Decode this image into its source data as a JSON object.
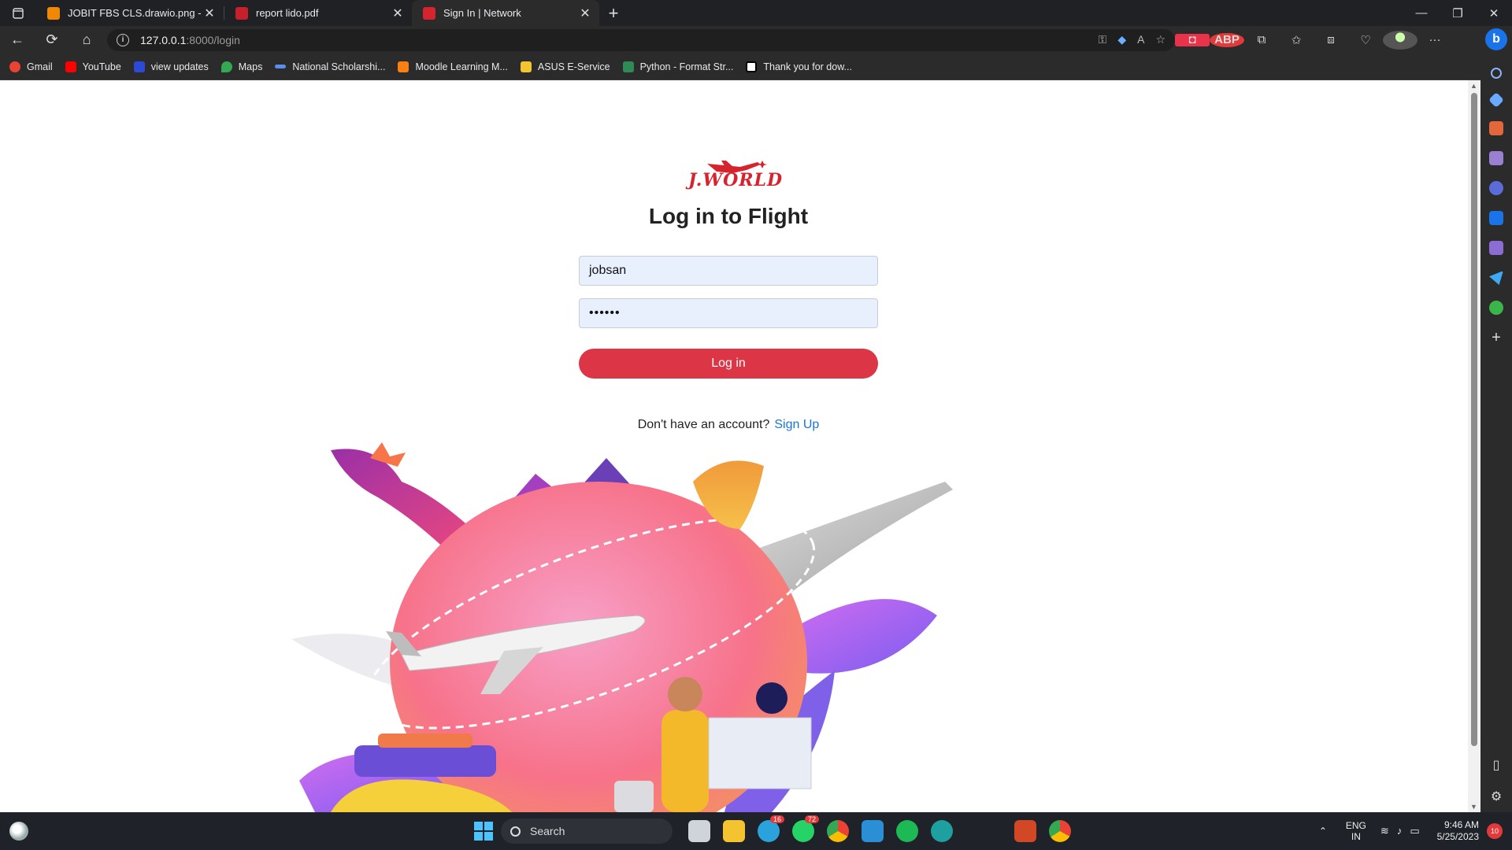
{
  "browser": {
    "tabs": [
      {
        "title": "JOBIT FBS CLS.drawio.png - draw",
        "favicon_color": "#f08705",
        "active": false
      },
      {
        "title": "report lido.pdf",
        "favicon_color": "#c8202b",
        "active": false
      },
      {
        "title": "Sign In | Network",
        "favicon_color": "#d6232e",
        "active": true
      }
    ],
    "address": {
      "host": "127.0.0.1",
      "path": ":8000/login"
    },
    "bookmarks": [
      {
        "label": "Gmail",
        "color": "#ea4335"
      },
      {
        "label": "YouTube",
        "color": "#ff0000"
      },
      {
        "label": "view updates",
        "color": "#2d4ad6"
      },
      {
        "label": "Maps",
        "color": "#34a853"
      },
      {
        "label": "National Scholarshi...",
        "color": "#5a8dee"
      },
      {
        "label": "Moodle Learning M...",
        "color": "#f98012"
      },
      {
        "label": "ASUS E-Service",
        "color": "#f4c430"
      },
      {
        "label": "Python - Format Str...",
        "color": "#2e8b57"
      },
      {
        "label": "Thank you for dow...",
        "color": "#ffffff"
      }
    ],
    "extensions": {
      "abp": "ABP"
    }
  },
  "page": {
    "logo_text": "J.WORLD",
    "title": "Log in to Flight",
    "username_value": "jobsan",
    "password_value": "••••••",
    "login_button": "Log in",
    "signup_prompt": "Don't have an account?",
    "signup_link": "Sign Up"
  },
  "taskbar": {
    "search_label": "Search",
    "apps": [
      {
        "name": "task-view",
        "color": "#cfd3da",
        "badge": null
      },
      {
        "name": "file-explorer",
        "color": "#f4c430",
        "badge": null
      },
      {
        "name": "telegram",
        "color": "#2aa3dd",
        "badge": "16"
      },
      {
        "name": "whatsapp",
        "color": "#25d366",
        "badge": "72"
      },
      {
        "name": "chrome",
        "color": "#f0b400",
        "badge": null
      },
      {
        "name": "vscode",
        "color": "#2b8fd6",
        "badge": null
      },
      {
        "name": "spotify",
        "color": "#1db954",
        "badge": null
      },
      {
        "name": "edge",
        "color": "#1ea0a0",
        "badge": null
      },
      {
        "name": "powerpoint",
        "color": "#d24726",
        "badge": null
      },
      {
        "name": "chrome-profile",
        "color": "#e34133",
        "badge": null
      }
    ],
    "lang_1": "ENG",
    "lang_2": "IN",
    "time": "9:46 AM",
    "date": "5/25/2023",
    "notifications": "10"
  }
}
